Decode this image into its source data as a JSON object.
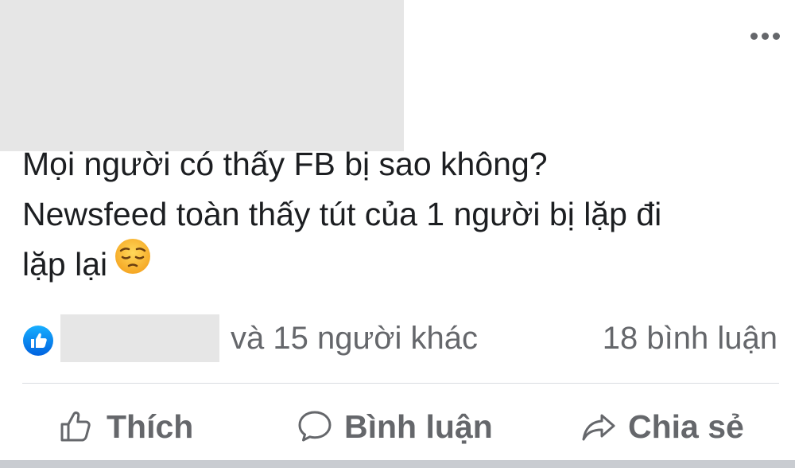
{
  "post": {
    "header_redacted": true,
    "more_options_icon": "more-horizontal-icon",
    "text_lines": [
      "Mọi người có thấy FB bị sao không?",
      "Newsfeed toàn thấy tút của 1 người bị lặp đi",
      "lặp lại"
    ],
    "emoji": "pensive-face-emoji"
  },
  "reactions": {
    "icon": "like-badge-icon",
    "names_redacted": true,
    "others_text": "và 15 người khác",
    "comments_text": "18 bình luận"
  },
  "actions": {
    "like_label": "Thích",
    "like_icon": "thumbs-up-icon",
    "comment_label": "Bình luận",
    "comment_icon": "speech-bubble-icon",
    "share_label": "Chia sẻ",
    "share_icon": "share-arrow-icon"
  },
  "colors": {
    "text_primary": "#1c1e21",
    "text_secondary": "#65676b",
    "like_blue": "#1877f2",
    "redaction_gray": "#e6e6e6",
    "divider": "#dadde1"
  }
}
